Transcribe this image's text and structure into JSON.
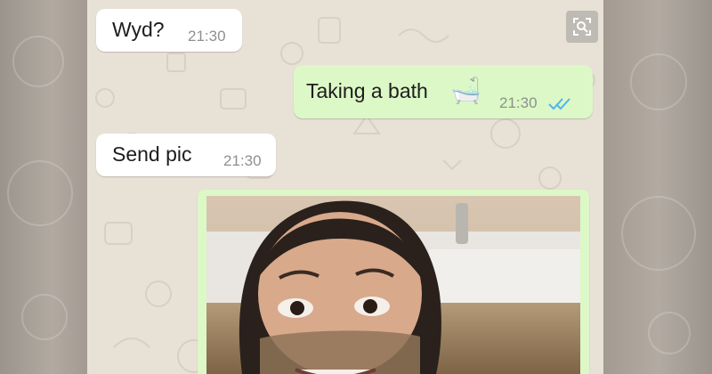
{
  "messages": [
    {
      "direction": "incoming",
      "text": "Wyd?",
      "time": "21:30"
    },
    {
      "direction": "outgoing",
      "text": "Taking a bath",
      "emoji": "🛁",
      "time": "21:30",
      "status": "read"
    },
    {
      "direction": "incoming",
      "text": "Send pic",
      "time": "21:30"
    }
  ],
  "photo_message": {
    "direction": "outgoing",
    "content": "image"
  },
  "controls": {
    "expand_icon": "expand-icon"
  },
  "colors": {
    "incoming_bubble": "#ffffff",
    "outgoing_bubble": "#dcf8c6",
    "wallpaper": "#e8e1d6",
    "read_ticks": "#4fb6ec",
    "timestamp": "#8d918d"
  }
}
